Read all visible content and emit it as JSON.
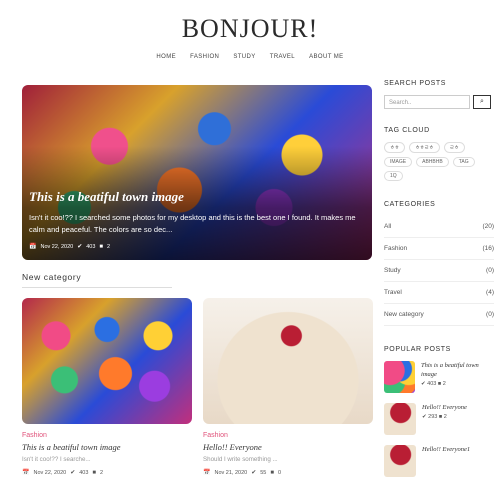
{
  "brand": "BONJOUR!",
  "nav": [
    "HOME",
    "FASHION",
    "STUDY",
    "TRAVEL",
    "ABOUT ME"
  ],
  "hero": {
    "title": "This is a beatiful town image",
    "excerpt": "Isn't it coo!?? I searched some photos for my desktop and this is the best one I found. It makes me calm and peaceful. The colors are so dec...",
    "date": "Nov 22, 2020",
    "views": "403",
    "comments": "2"
  },
  "section": "New category",
  "cards": [
    {
      "category": "Fashion",
      "title": "This is a beatiful town image",
      "excerpt": "Isn't it coo!?? I searche...",
      "date": "Nov 22, 2020",
      "views": "403",
      "comments": "2"
    },
    {
      "category": "Fashion",
      "title": "Hello!! Everyone",
      "excerpt": "Should I write something ...",
      "date": "Nov 21, 2020",
      "views": "55",
      "comments": "0"
    }
  ],
  "sidebar": {
    "search_title": "SEARCH POSTS",
    "search_placeholder": "Search..",
    "tagcloud_title": "TAG CLOUD",
    "tags": [
      "ㅎㅎ",
      "ㅎㅎㄹㅎ",
      "ㄹㅎ",
      "IMAGE",
      "ABHBHB",
      "TAG",
      "1Q"
    ],
    "categories_title": "CATEGORIES",
    "categories": [
      {
        "name": "All",
        "count": "(20)"
      },
      {
        "name": "Fashion",
        "count": "(16)"
      },
      {
        "name": "Study",
        "count": "(0)"
      },
      {
        "name": "Travel",
        "count": "(4)"
      },
      {
        "name": "New category",
        "count": "(0)"
      }
    ],
    "popular_title": "POPULAR POSTS",
    "popular": [
      {
        "title": "This is a beatiful town image",
        "views": "403",
        "comments": "2"
      },
      {
        "title": "Hello!! Everyone",
        "views": "293",
        "comments": "2"
      },
      {
        "title": "Hello!! Everyone1",
        "views": "",
        "comments": ""
      }
    ]
  },
  "icons": {
    "calendar": "calendar-icon",
    "views": "check-icon",
    "comments": "comment-icon",
    "search": "search-icon"
  }
}
